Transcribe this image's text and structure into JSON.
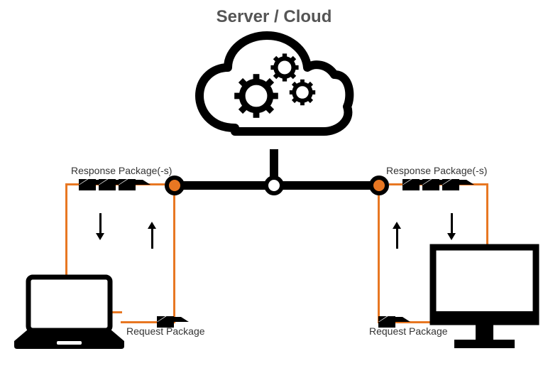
{
  "title": "Server / Cloud",
  "labels": {
    "response_left": "Response Package(-s)",
    "response_right": "Response Package(-s)",
    "request_left": "Request Package",
    "request_right": "Request Package"
  },
  "nodes": {
    "center": "hub-center",
    "left": "hub-left",
    "right": "hub-right"
  },
  "devices": {
    "left": "laptop",
    "right": "desktop-monitor"
  },
  "packets": {
    "response_left_count": 3,
    "response_right_count": 3,
    "request_left_count": 1,
    "request_right_count": 1
  },
  "colors": {
    "accent": "#e87722",
    "ink": "#000000"
  }
}
